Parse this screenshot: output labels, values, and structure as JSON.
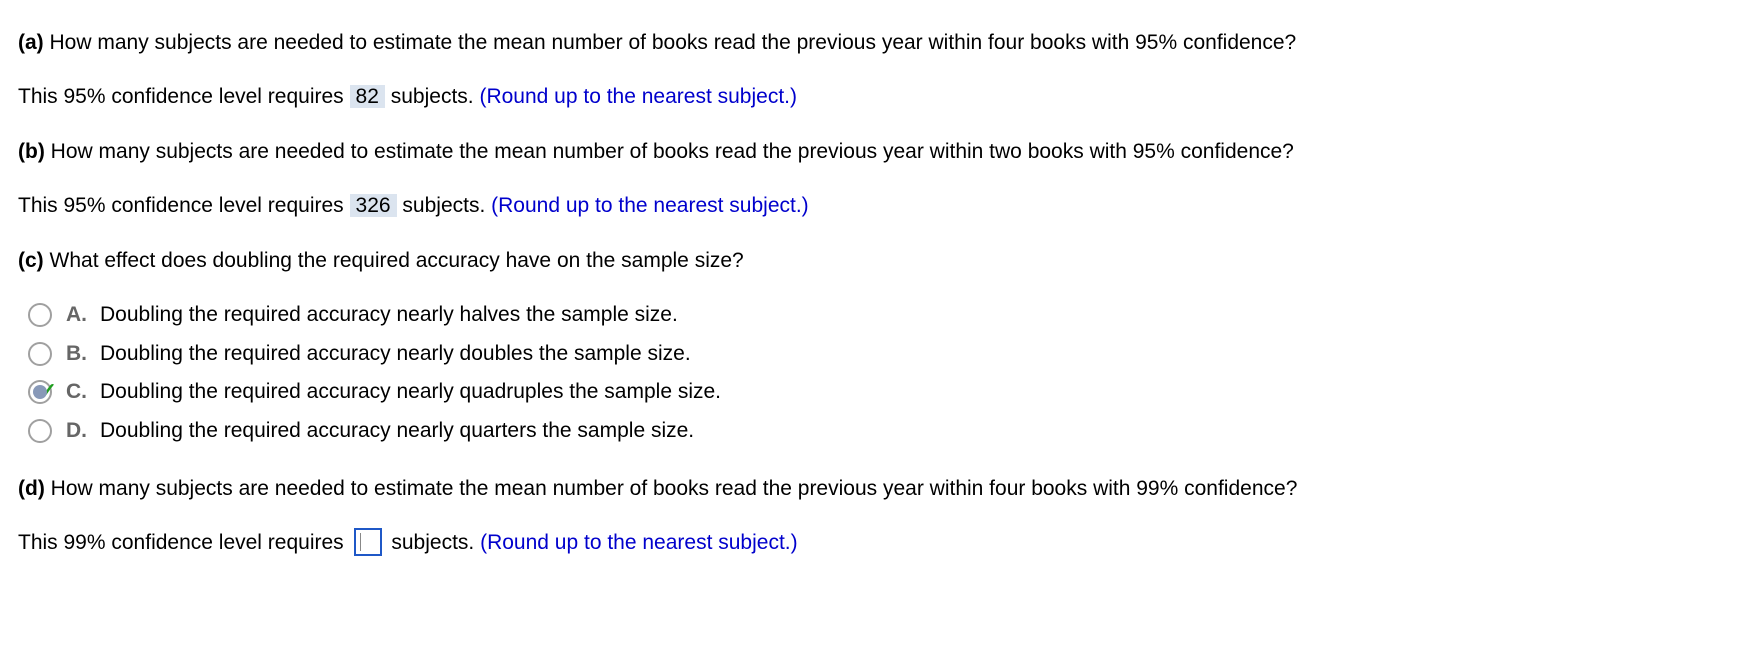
{
  "partA": {
    "label": "(a)",
    "question": "How many subjects are needed to estimate the mean number of books read the previous year within four books with 95% confidence?",
    "answer_prefix": "This 95% confidence level requires",
    "answer_value": "82",
    "answer_suffix": "subjects.",
    "hint": "(Round up to the nearest subject.)"
  },
  "partB": {
    "label": "(b)",
    "question": "How many subjects are needed to estimate the mean number of books read the previous year within two books with 95% confidence?",
    "answer_prefix": "This 95% confidence level requires",
    "answer_value": "326",
    "answer_suffix": "subjects.",
    "hint": "(Round up to the nearest subject.)"
  },
  "partC": {
    "label": "(c)",
    "question": "What effect does doubling the required accuracy have on the sample size?",
    "options": [
      {
        "letter": "A.",
        "text": "Doubling the required accuracy nearly halves the sample size.",
        "selected": false,
        "correct": false
      },
      {
        "letter": "B.",
        "text": "Doubling the required accuracy nearly doubles the sample size.",
        "selected": false,
        "correct": false
      },
      {
        "letter": "C.",
        "text": "Doubling the required accuracy nearly quadruples the sample size.",
        "selected": true,
        "correct": true
      },
      {
        "letter": "D.",
        "text": "Doubling the required accuracy nearly quarters the sample size.",
        "selected": false,
        "correct": false
      }
    ]
  },
  "partD": {
    "label": "(d)",
    "question": "How many subjects are needed to estimate the mean number of books read the previous year within four books with 99% confidence?",
    "answer_prefix": "This 99% confidence level requires",
    "answer_value": "",
    "answer_suffix": "subjects.",
    "hint": "(Round up to the nearest subject.)"
  }
}
